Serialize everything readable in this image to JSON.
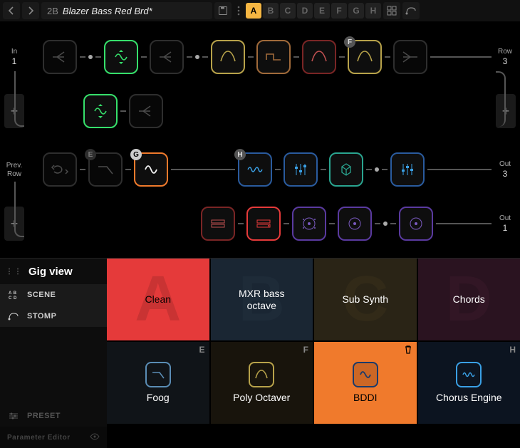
{
  "topbar": {
    "preset_number": "2B",
    "preset_title": "Blazer Bass Red Brd*",
    "scenes": [
      "A",
      "B",
      "C",
      "D",
      "E",
      "F",
      "G",
      "H"
    ],
    "active_scene": "A"
  },
  "chain": {
    "in_label": "In",
    "in_num": "1",
    "prev_label": "Prev.",
    "prev_sub": "Row",
    "row3_label": "Row",
    "row3_num": "3",
    "out3_label": "Out",
    "out3_num": "3",
    "out1_label": "Out",
    "out1_num": "1",
    "badges": {
      "e": "E",
      "f": "F",
      "g": "G",
      "h": "H"
    },
    "colors": {
      "green": "#36e06b",
      "gray": "#6e6e6e",
      "olive": "#b7a24a",
      "brown": "#a06a3a",
      "red": "#e53a3a",
      "darkred": "#7a2525",
      "orange": "#f07a2c",
      "blue": "#3aa0e5",
      "dblue": "#2a5b9e",
      "teal": "#2aa590",
      "purple": "#5a3aa0"
    }
  },
  "side": {
    "title": "Gig view",
    "scene": "SCENE",
    "stomp": "STOMP",
    "preset": "PRESET",
    "param": "Parameter Editor"
  },
  "stomps": {
    "a": {
      "letter": "A",
      "label": "Clean",
      "bg": "#e53a3a",
      "letter_color": "#7a1f1f"
    },
    "b": {
      "letter": "B",
      "label": "MXR bass\noctave",
      "bg": "#1a2633",
      "letter_color": "#2a3a4a"
    },
    "c": {
      "letter": "C",
      "label": "Sub Synth",
      "bg": "#2a2416",
      "letter_color": "#4a3f1f"
    },
    "d": {
      "letter": "D",
      "label": "Chords",
      "bg": "#2a1320",
      "letter_color": "#4a1f35"
    },
    "e": {
      "letter": "E",
      "label": "Foog",
      "bg": "#101418",
      "icon": "#5a8db5"
    },
    "f": {
      "letter": "F",
      "label": "Poly Octaver",
      "bg": "#18140c",
      "icon": "#b7a24a"
    },
    "g": {
      "letter": "G",
      "label": "BDDI",
      "bg": "#f07a2c",
      "icon": "#2a5b9e"
    },
    "h": {
      "letter": "H",
      "label": "Chorus Engine",
      "bg": "#0c1420",
      "icon": "#3aa0e5"
    }
  }
}
